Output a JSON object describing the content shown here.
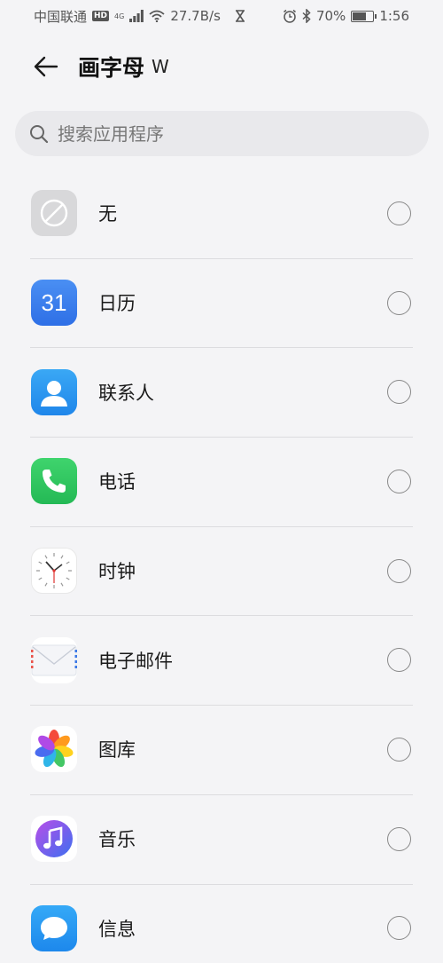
{
  "status_bar": {
    "carrier": "中国联通",
    "hd": "HD",
    "network": "4G",
    "speed": "27.7B/s",
    "battery": "70%",
    "battery_level": 0.7,
    "time": "1:56"
  },
  "header": {
    "title": "画字母",
    "title_suffix": "W",
    "back_icon": "arrow-left-icon"
  },
  "search": {
    "placeholder": "搜索应用程序",
    "value": ""
  },
  "apps": [
    {
      "label": "无",
      "icon": "none-icon",
      "selected": false
    },
    {
      "label": "日历",
      "icon": "calendar-icon",
      "icon_text": "31",
      "selected": false
    },
    {
      "label": "联系人",
      "icon": "contacts-icon",
      "selected": false
    },
    {
      "label": "电话",
      "icon": "phone-icon",
      "selected": false
    },
    {
      "label": "时钟",
      "icon": "clock-icon",
      "selected": false
    },
    {
      "label": "电子邮件",
      "icon": "email-icon",
      "selected": false
    },
    {
      "label": "图库",
      "icon": "gallery-icon",
      "selected": false
    },
    {
      "label": "音乐",
      "icon": "music-icon",
      "selected": false
    },
    {
      "label": "信息",
      "icon": "messages-icon",
      "selected": false
    }
  ],
  "colors": {
    "background": "#f4f4f6",
    "search_bg": "#e9e9ec",
    "divider": "#dcdcdf"
  }
}
